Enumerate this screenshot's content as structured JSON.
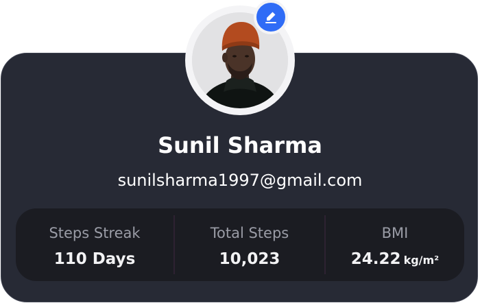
{
  "profile": {
    "name": "Sunil Sharma",
    "email": "sunilsharma1997@gmail.com"
  },
  "stats": [
    {
      "label": "Steps Streak",
      "value": "110 Days",
      "unit": ""
    },
    {
      "label": "Total Steps",
      "value": "10,023",
      "unit": ""
    },
    {
      "label": "BMI",
      "value": "24.22",
      "unit": "kg/m²"
    }
  ],
  "colors": {
    "card_background": "#272a35",
    "stats_background": "#1b1c22",
    "edit_badge": "#2f6cf6",
    "label_text": "#9a9ca6",
    "primary_text": "#ffffff"
  },
  "icons": {
    "edit": "pencil-icon"
  }
}
